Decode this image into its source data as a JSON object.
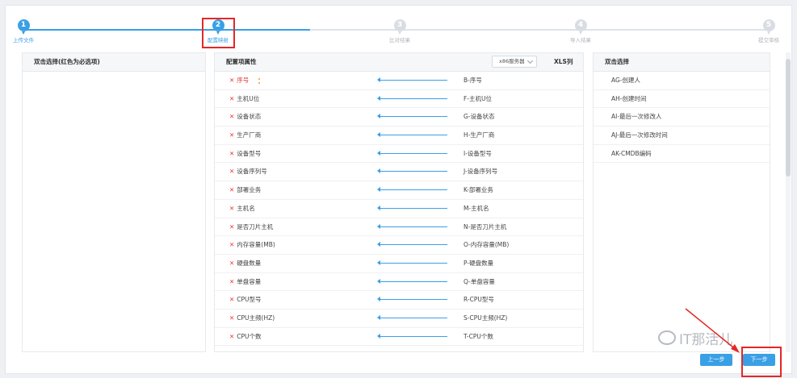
{
  "steps": [
    {
      "number": "1",
      "label": "上传文件",
      "active": true
    },
    {
      "number": "2",
      "label": "配置映射",
      "active": true
    },
    {
      "number": "3",
      "label": "比对结果",
      "active": false
    },
    {
      "number": "4",
      "label": "导入结果",
      "active": false
    },
    {
      "number": "5",
      "label": "提交审核",
      "active": false
    }
  ],
  "left_panel": {
    "title": "双击选择(红色为必选项)"
  },
  "middle_panel": {
    "title": "配置项属性",
    "select_value": "x86服务器",
    "xls_label": "XLS列",
    "rows": [
      {
        "attr": "序号",
        "col": "B-序号"
      },
      {
        "attr": "主机U位",
        "col": "F-主机U位"
      },
      {
        "attr": "设备状态",
        "col": "G-设备状态"
      },
      {
        "attr": "生产厂商",
        "col": "H-生产厂商"
      },
      {
        "attr": "设备型号",
        "col": "I-设备型号"
      },
      {
        "attr": "设备序列号",
        "col": "J-设备序列号"
      },
      {
        "attr": "部署业务",
        "col": "K-部署业务"
      },
      {
        "attr": "主机名",
        "col": "M-主机名"
      },
      {
        "attr": "是否刀片主机",
        "col": "N-是否刀片主机"
      },
      {
        "attr": "内存容量(MB)",
        "col": "O-内存容量(MB)"
      },
      {
        "attr": "硬盘数量",
        "col": "P-硬盘数量"
      },
      {
        "attr": "单盘容量",
        "col": "Q-单盘容量"
      },
      {
        "attr": "CPU型号",
        "col": "R-CPU型号"
      },
      {
        "attr": "CPU主频(HZ)",
        "col": "S-CPU主频(HZ)"
      },
      {
        "attr": "CPU个数",
        "col": "T-CPU个数"
      }
    ]
  },
  "right_panel": {
    "title": "双击选择",
    "items": [
      "AG-创建人",
      "AH-创建时间",
      "AI-最后一次修改人",
      "AJ-最后一次修改时间",
      "AK-CMDB编码"
    ]
  },
  "buttons": {
    "prev": "上一步",
    "next": "下一步"
  },
  "watermark": "IT那活儿",
  "colors": {
    "accent": "#3aa0e6",
    "required_mark": "#e53935",
    "highlight": "#e52727"
  }
}
